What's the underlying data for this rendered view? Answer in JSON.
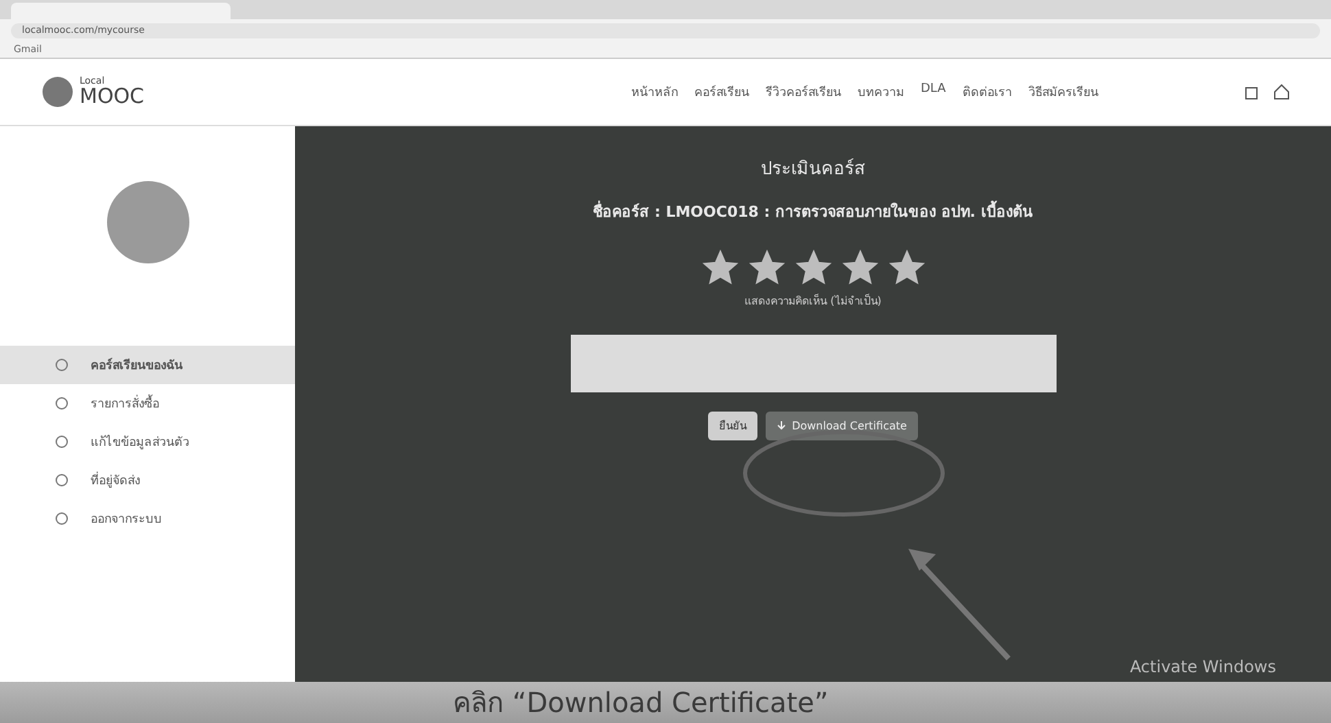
{
  "browser": {
    "url": "localmooc.com/mycourse",
    "bookmarks": [
      "Gmail"
    ]
  },
  "header": {
    "logo_top": "Local",
    "logo_main": "MOOC",
    "nav": [
      "หน้าหลัก",
      "คอร์สเรียน",
      "รีวิวคอร์สเรียน",
      "บทความ",
      "DLA",
      "ติดต่อเรา",
      "วิธีสมัครเรียน"
    ]
  },
  "sidebar": {
    "items": [
      {
        "label": "คอร์สเรียนของฉัน",
        "selected": true
      },
      {
        "label": "รายการสั่งซื้อ",
        "selected": false
      },
      {
        "label": "แก้ไขข้อมูลส่วนตัว",
        "selected": false
      },
      {
        "label": "ที่อยู่จัดส่ง",
        "selected": false
      },
      {
        "label": "ออกจากระบบ",
        "selected": false
      }
    ]
  },
  "review": {
    "title": "ประเมินคอร์ส",
    "course": "ชื่อคอร์ส : LMOOC018 : การตรวจสอบภายในของ อปท. เบื้องต้น",
    "stars": 5,
    "comment_label": "แสดงความคิดเห็น (ไม่จำเป็น)",
    "buttons": [
      "ยืนยัน",
      "Download Certificate"
    ]
  },
  "watermark_text": "Activate Windows",
  "caption": "คลิก “Download Certificate”"
}
